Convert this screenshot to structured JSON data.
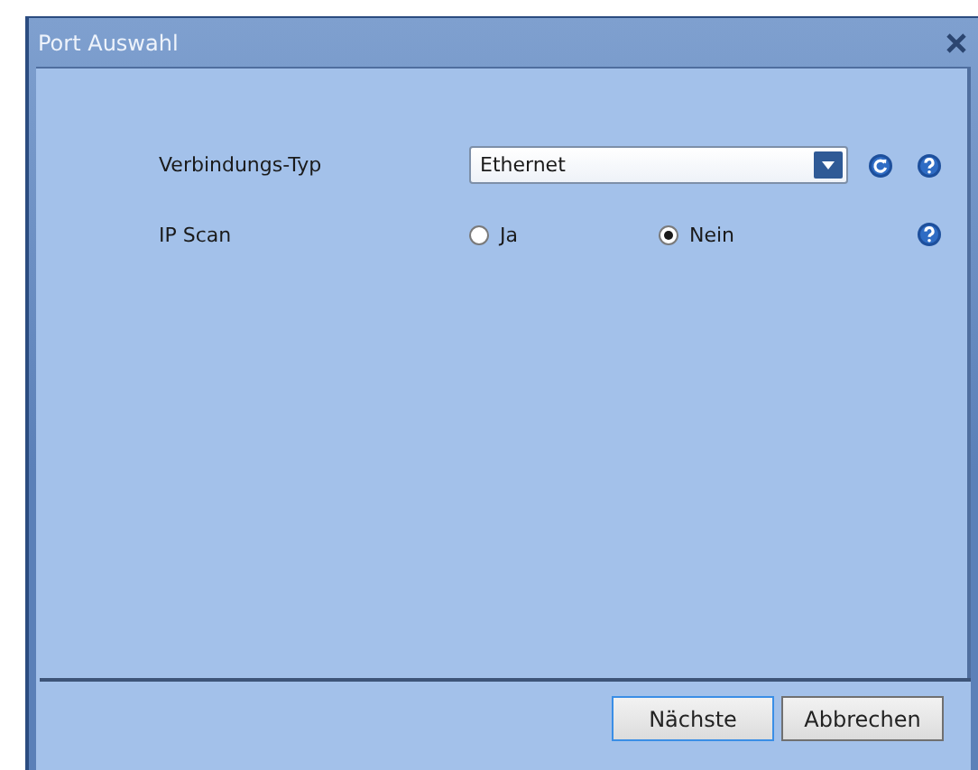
{
  "window": {
    "title": "Port Auswahl"
  },
  "fields": [
    {
      "kind": "dropdown",
      "label": "Verbindungs-Typ",
      "value": "Ethernet"
    },
    {
      "kind": "radio",
      "label": "IP Scan",
      "options": [
        {
          "label": "Ja",
          "selected": false
        },
        {
          "label": "Nein",
          "selected": true
        }
      ]
    }
  ],
  "buttons": [
    {
      "label": "Nächste",
      "focused": true
    },
    {
      "label": "Abbrechen",
      "focused": false
    }
  ]
}
